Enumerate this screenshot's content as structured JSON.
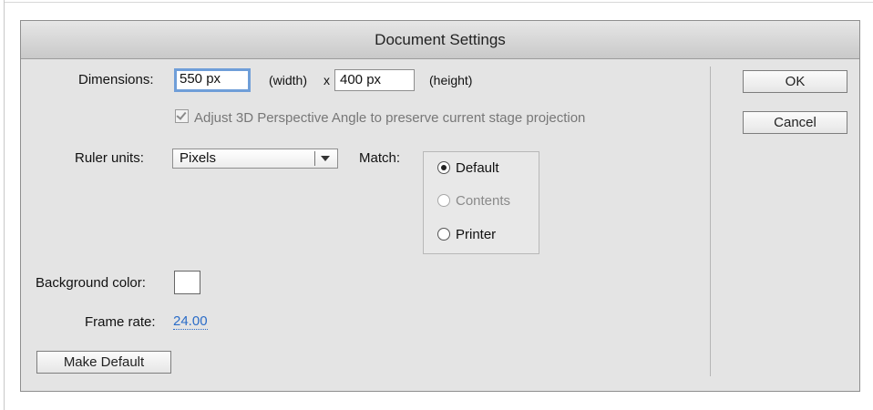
{
  "dialog": {
    "title": "Document Settings"
  },
  "dimensions": {
    "label": "Dimensions:",
    "width_value": "550 px",
    "width_suffix": "(width)",
    "times": "x",
    "height_value": "400 px",
    "height_suffix": "(height)"
  },
  "perspective_checkbox": {
    "label": "Adjust 3D Perspective Angle to preserve current stage projection",
    "checked": true
  },
  "ruler": {
    "label": "Ruler units:",
    "selected": "Pixels"
  },
  "match": {
    "label": "Match:",
    "options": [
      {
        "label": "Default",
        "checked": true,
        "disabled": false
      },
      {
        "label": "Contents",
        "checked": false,
        "disabled": true
      },
      {
        "label": "Printer",
        "checked": false,
        "disabled": false
      }
    ]
  },
  "background": {
    "label": "Background color:",
    "color": "#ffffff"
  },
  "frame_rate": {
    "label": "Frame rate:",
    "value": "24.00"
  },
  "buttons": {
    "make_default": "Make Default",
    "ok": "OK",
    "cancel": "Cancel"
  },
  "colors": {
    "link": "#2a6cc8",
    "focus_ring": "#6f9ed8"
  }
}
